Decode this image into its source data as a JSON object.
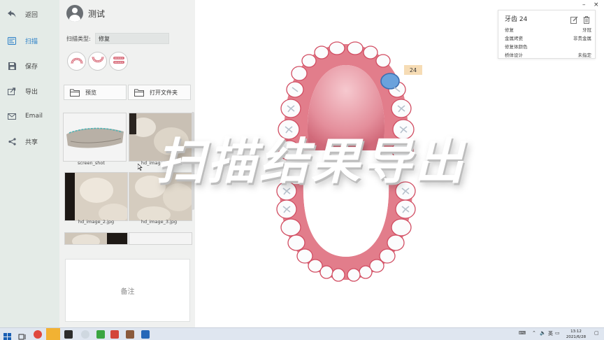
{
  "nav": {
    "items": [
      {
        "label": "返回",
        "icon": "back-arrow-icon"
      },
      {
        "label": "扫描",
        "icon": "scan-icon",
        "active": true
      },
      {
        "label": "保存",
        "icon": "save-icon"
      },
      {
        "label": "导出",
        "icon": "export-icon"
      },
      {
        "label": "Email",
        "icon": "mail-icon"
      },
      {
        "label": "共享",
        "icon": "share-icon"
      }
    ]
  },
  "panel": {
    "user_name": "测试",
    "scan_type_label": "扫描类型:",
    "scan_type_value": "修复",
    "preview_label": "预览",
    "open_folder_label": "打开文件夹",
    "thumbnails": [
      {
        "label": "screen_shot"
      },
      {
        "label": "hd_image_1.jpg"
      },
      {
        "label": "hd_image_2.jpg"
      },
      {
        "label": "hd_image_3.jpg"
      }
    ],
    "note_placeholder": "备注"
  },
  "canvas": {
    "selected_tooth_label": "24",
    "overlay_title": "扫描结果导出"
  },
  "info_card": {
    "title": "牙齿 24",
    "rows": [
      {
        "key": "修复",
        "value": "牙冠"
      },
      {
        "key": "金属烤瓷",
        "value": "非贵金属"
      },
      {
        "key": "修复体颜色",
        "value": ""
      },
      {
        "key": "桥体设计",
        "value": "未指定"
      }
    ]
  },
  "window": {
    "minimize": "–",
    "close": "×"
  },
  "taskbar": {
    "tray_ime": "英",
    "clock_time": "13:12",
    "clock_date": "2021/6/28"
  },
  "colors": {
    "accent": "#2a7fc7",
    "gum": "#e08a96",
    "tooth_selected": "#6aa2dc",
    "tooth_label_bg": "#f6dcb5"
  }
}
